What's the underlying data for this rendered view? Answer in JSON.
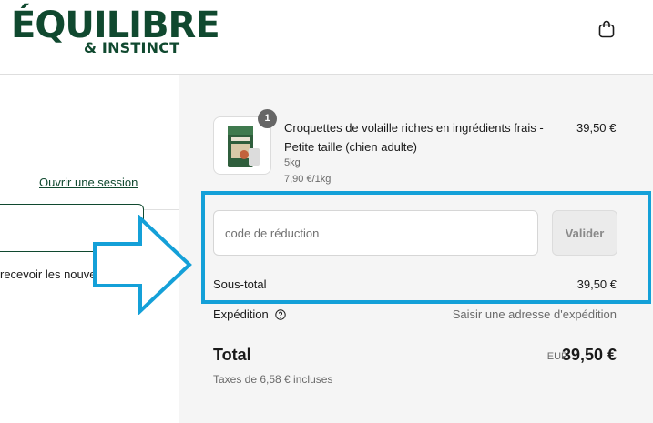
{
  "header": {
    "logo_main": "ÉQUILIBRE",
    "logo_sub": "& INSTINCT",
    "cart_icon": "shopping-bag-icon"
  },
  "contact": {
    "login_link": "Ouvrir une session",
    "email_value": "",
    "newsletter_label": "recevoir les nouveautés"
  },
  "order_summary": {
    "item": {
      "quantity": "1",
      "title": "Croquettes de volaille riches en ingrédients frais - Petite taille (chien adulte)",
      "variant": "5kg",
      "unit_price": "7,90 €/1kg",
      "price": "39,50 €"
    },
    "discount": {
      "placeholder": "code de réduction",
      "button_label": "Valider"
    },
    "subtotal_label": "Sous-total",
    "subtotal_value": "39,50 €",
    "shipping_label": "Expédition",
    "shipping_value": "Saisir une adresse d'expédition",
    "total_label": "Total",
    "total_currency": "EUR",
    "total_value": "39,50 €",
    "taxes_note": "Taxes de 6,58 € incluses"
  },
  "colors": {
    "brand": "#10492f",
    "annotation": "#14a0d8",
    "summary_bg": "#f5f5f5"
  }
}
